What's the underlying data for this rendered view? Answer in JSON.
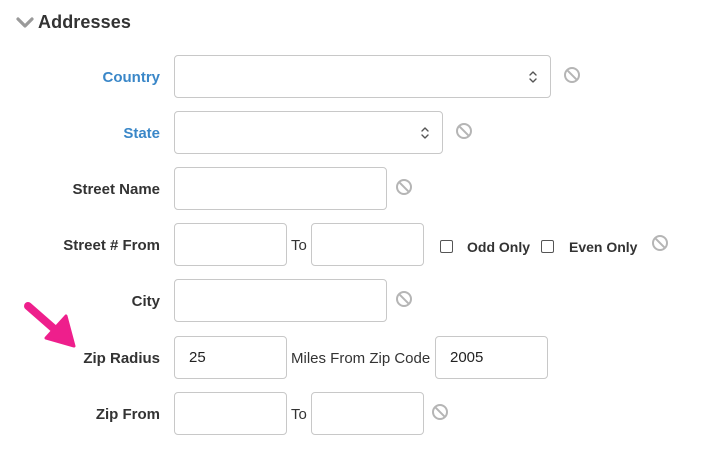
{
  "section": {
    "title": "Addresses",
    "collapse_icon": "chevron-down-icon"
  },
  "colors": {
    "link": "#3a87c8",
    "arrow": "#ee1f8c",
    "border": "#c8c8c8",
    "clear_icon": "#b5b5b5"
  },
  "fields": {
    "country": {
      "label": "Country",
      "value": ""
    },
    "state": {
      "label": "State",
      "value": ""
    },
    "street_name": {
      "label": "Street Name",
      "value": ""
    },
    "street_number": {
      "label": "Street # From",
      "from_value": "",
      "to_label": "To",
      "to_value": "",
      "odd_only_label": "Odd Only",
      "even_only_label": "Even Only"
    },
    "city": {
      "label": "City",
      "value": ""
    },
    "zip_radius": {
      "label": "Zip Radius",
      "radius_value": "25",
      "miles_label": "Miles From Zip Code",
      "zip_value": "2005"
    },
    "zip_from": {
      "label": "Zip From",
      "from_value": "",
      "to_label": "To",
      "to_value": ""
    }
  },
  "icons": {
    "clear": "clear-circle-slash-icon",
    "select_arrow": "chevron-up-down-icon",
    "annotation": "pointer-arrow-icon"
  }
}
